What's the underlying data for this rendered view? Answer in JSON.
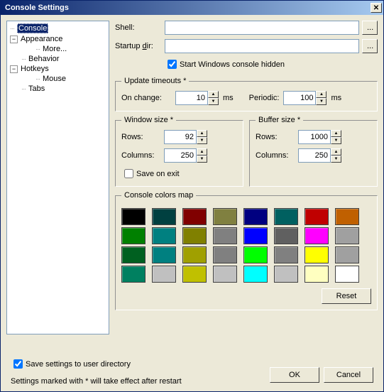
{
  "title": "Console Settings",
  "tree": {
    "console": "Console",
    "appearance": "Appearance",
    "more": "More...",
    "behavior": "Behavior",
    "hotkeys": "Hotkeys",
    "mouse": "Mouse",
    "tabs": "Tabs"
  },
  "shell": {
    "label": "Shell:",
    "value": ""
  },
  "startup": {
    "label_pre": "Startup ",
    "label_u": "d",
    "label_post": "ir:",
    "value": ""
  },
  "browse": "...",
  "start_hidden": "Start Windows console hidden",
  "timeouts": {
    "legend": "Update timeouts *",
    "on_change": "On change:",
    "on_change_val": "10",
    "periodic": "Periodic:",
    "periodic_val": "100",
    "ms": "ms"
  },
  "window_size": {
    "legend": "Window size *",
    "rows_u": "R",
    "rows_post": "ows:",
    "rows_val": "92",
    "cols_u": "C",
    "cols_post": "olumns:",
    "cols_val": "250",
    "save_exit": "Save on exit"
  },
  "buffer_size": {
    "legend": "Buffer size *",
    "rows_u": "R",
    "rows_post": "ows:",
    "rows_val": "1000",
    "cols_u": "C",
    "cols_post": "olumns:",
    "cols_val": "250"
  },
  "colors": {
    "legend": "Console colors map",
    "reset": "Reset",
    "swatches": [
      "#000000",
      "#004040",
      "#800000",
      "#808040",
      "#000080",
      "#006060",
      "#c00000",
      "#c06000",
      "#008000",
      "#008080",
      "#808000",
      "#808080",
      "#0000ff",
      "#606060",
      "#ff00ff",
      "#a0a0a0",
      "#006020",
      "#008080",
      "#a0a000",
      "#808080",
      "#00ff00",
      "#808080",
      "#ffff00",
      "#a0a0a0",
      "#008060",
      "#c0c0c0",
      "#c0c000",
      "#c0c0c0",
      "#00ffff",
      "#c0c0c0",
      "#ffffc0",
      "#ffffff"
    ]
  },
  "save_user_dir": "Save settings to user directory",
  "note": "Settings marked with * will take effect after restart",
  "ok": "OK",
  "cancel": "Cancel"
}
